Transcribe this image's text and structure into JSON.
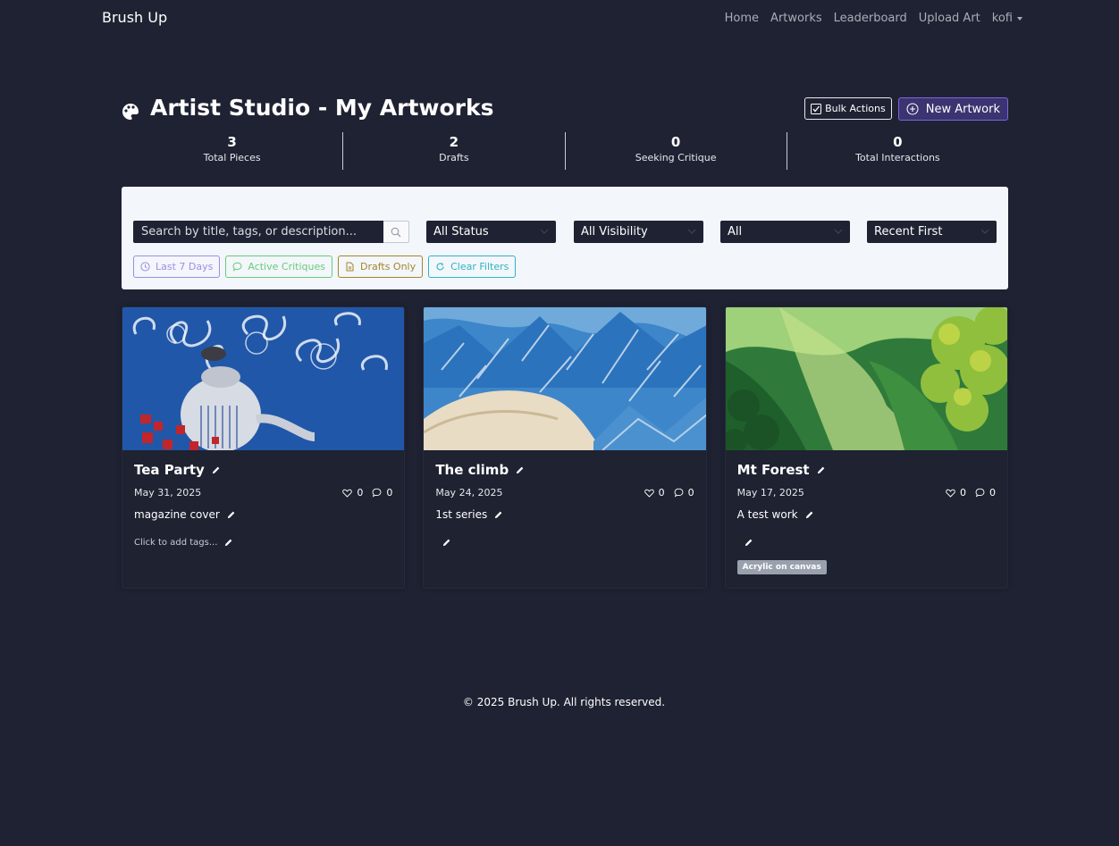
{
  "app": {
    "brand": "Brush Up"
  },
  "nav": {
    "links": [
      "Home",
      "Artworks",
      "Leaderboard",
      "Upload Art"
    ],
    "user": "kofi"
  },
  "header": {
    "title": "Artist Studio - My Artworks",
    "bulk_actions": "Bulk Actions",
    "new_artwork": "New Artwork"
  },
  "stats": [
    {
      "value": "3",
      "label": "Total Pieces"
    },
    {
      "value": "2",
      "label": "Drafts"
    },
    {
      "value": "0",
      "label": "Seeking Critique"
    },
    {
      "value": "0",
      "label": "Total Interactions"
    }
  ],
  "filters": {
    "search_placeholder": "Search by title, tags, or description...",
    "status": "All Status",
    "visibility": "All Visibility",
    "category": "All",
    "sort": "Recent First",
    "quick": [
      {
        "label": "Last 7 Days",
        "color": "#9b8ee8",
        "icon": "clock-icon"
      },
      {
        "label": "Active Critiques",
        "color": "#66cc7a",
        "icon": "chat-icon"
      },
      {
        "label": "Drafts Only",
        "color": "#a3862a",
        "icon": "document-icon"
      },
      {
        "label": "Clear Filters",
        "color": "#2ab5c4",
        "icon": "refresh-icon"
      }
    ]
  },
  "artworks": [
    {
      "title": "Tea Party",
      "date": "May 31, 2025",
      "likes": "0",
      "comments": "0",
      "description": "magazine cover",
      "tags_text": "Click to add tags...",
      "tag": ""
    },
    {
      "title": "The climb",
      "date": "May 24, 2025",
      "likes": "0",
      "comments": "0",
      "description": "1st series",
      "tags_text": "",
      "tag": ""
    },
    {
      "title": "Mt Forest",
      "date": "May 17, 2025",
      "likes": "0",
      "comments": "0",
      "description": "A test work",
      "tags_text": "",
      "tag": "Acrylic on canvas"
    }
  ],
  "footer": {
    "text": "© 2025 Brush Up. All rights reserved."
  },
  "colors": {
    "background": "#1f2232",
    "accent": "#7d64e0",
    "panel": "#f3f6fa"
  }
}
